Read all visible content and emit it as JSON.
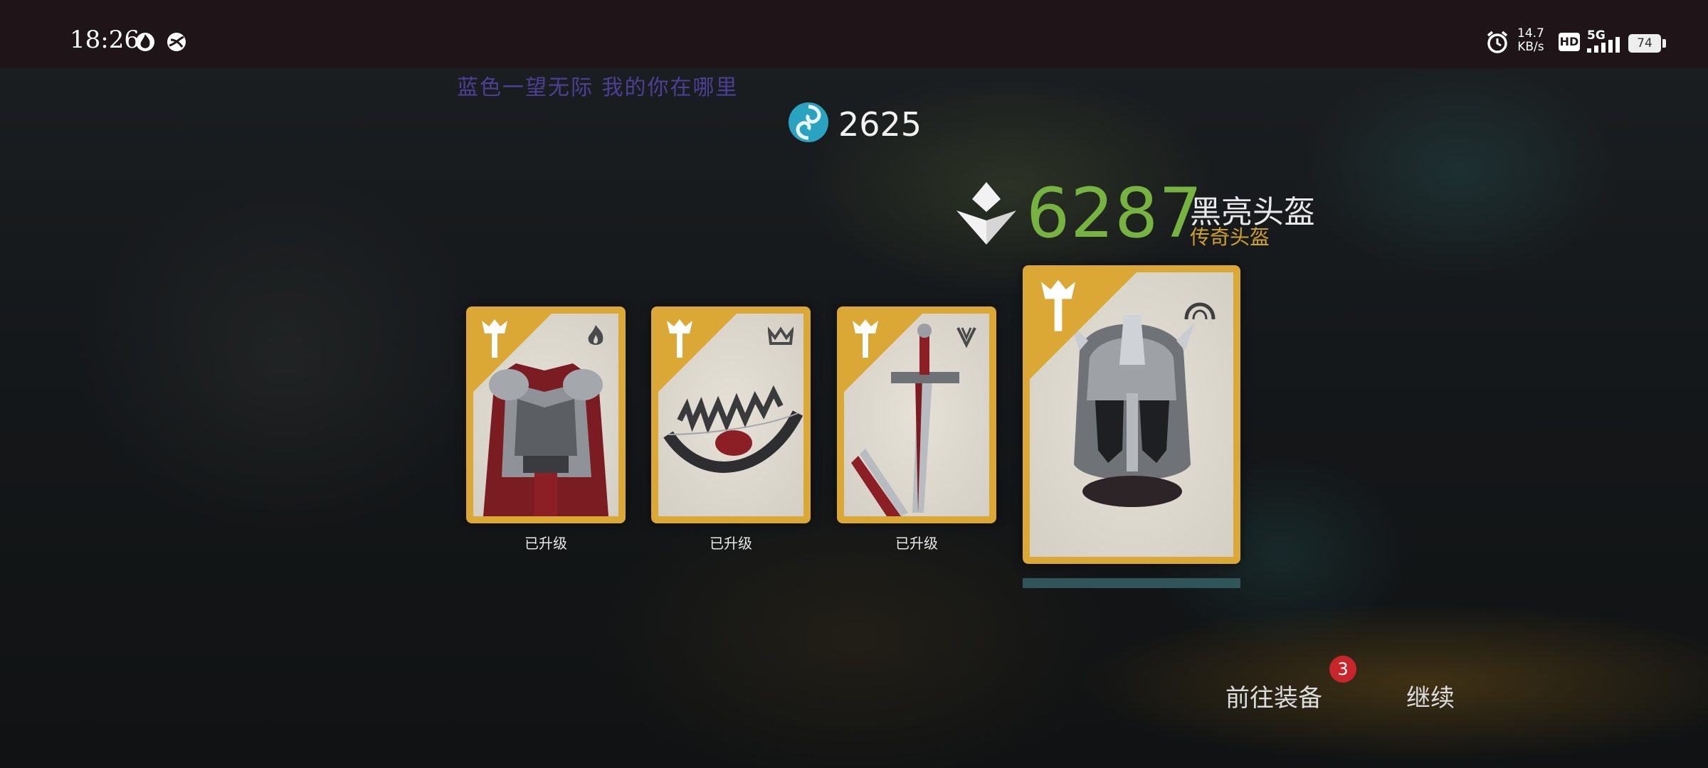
{
  "status_bar": {
    "time": "18:26",
    "net_speed_value": "14.7",
    "net_speed_unit": "KB/s",
    "hd": "HD",
    "network": "5G",
    "battery": "74",
    "icons": [
      "fire-app-icon",
      "ball-app-icon",
      "alarm-icon",
      "signal-icon",
      "battery-icon"
    ]
  },
  "caption": "蓝色一望无际 我的你在哪里",
  "currency": {
    "icon": "swirl-currency-icon",
    "value": "2625"
  },
  "reward": {
    "score": "6287",
    "name": "黑亮头盔",
    "type": "传奇头盔",
    "score_color": "#77b341",
    "type_color": "#cfa228"
  },
  "cards": [
    {
      "slot": "chest-armor",
      "slot_icon": "flame-icon",
      "status": "已升级"
    },
    {
      "slot": "bow",
      "slot_icon": "crown-icon",
      "status": "已升级"
    },
    {
      "slot": "sword",
      "slot_icon": "v-blade-icon",
      "status": "已升级"
    },
    {
      "slot": "helmet",
      "slot_icon": "arch-icon",
      "status": ""
    }
  ],
  "progress": {
    "fraction": 1.0
  },
  "actions": {
    "equip_label": "前往装备",
    "equip_badge": "3",
    "continue_label": "继续"
  },
  "colors": {
    "card_gold": "#dba735",
    "badge_red": "#c8262a"
  }
}
